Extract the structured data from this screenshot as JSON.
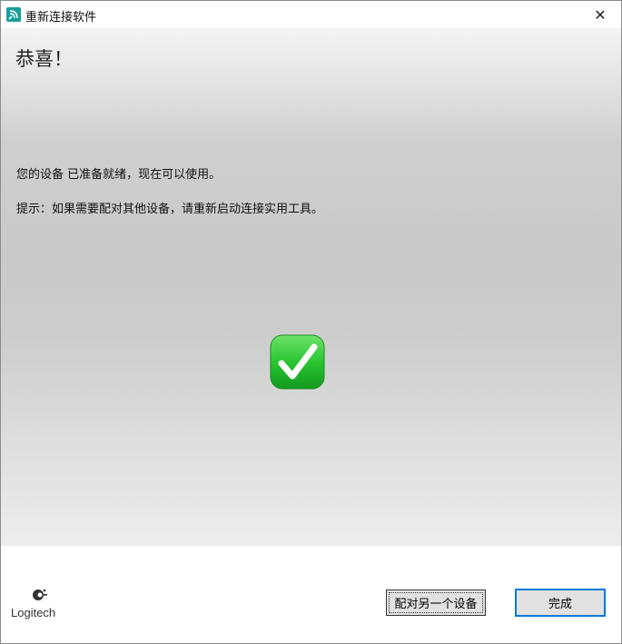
{
  "window": {
    "title": "重新连接软件",
    "app_icon": "logitech-connection-icon",
    "close_icon": "✕"
  },
  "main": {
    "heading": "恭喜！",
    "message": "您的设备 已准备就绪，现在可以使用。",
    "hint": "提示：如果需要配对其他设备，请重新启动连接实用工具。",
    "status_icon": "green-checkmark-icon",
    "status_color": "#29c531"
  },
  "footer": {
    "logo_text": "Logitech",
    "pair_button": "配对另一个设备",
    "done_button": "完成"
  }
}
